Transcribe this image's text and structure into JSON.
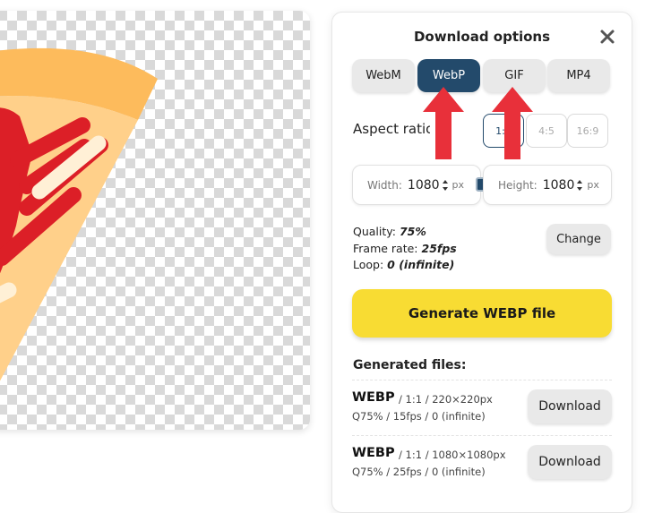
{
  "panel": {
    "title": "Download options",
    "close_icon": "close-icon"
  },
  "formats": [
    {
      "label": "WebM",
      "selected": false
    },
    {
      "label": "WebP",
      "selected": true
    },
    {
      "label": "GIF",
      "selected": false
    },
    {
      "label": "MP4",
      "selected": false
    }
  ],
  "aspect": {
    "label": "Aspect ratio",
    "options": [
      "1:1",
      "4:5",
      "16:9"
    ],
    "selected": "1:1"
  },
  "dimensions": {
    "width_label": "Width:",
    "width_value": "1080",
    "height_label": "Height:",
    "height_value": "1080",
    "unit": "px",
    "lock_icon": "lock-icon"
  },
  "settings": {
    "quality_label": "Quality:",
    "quality_value": "75%",
    "framerate_label": "Frame rate:",
    "framerate_value": "25fps",
    "loop_label": "Loop:",
    "loop_value": "0 (infinite)",
    "change_label": "Change"
  },
  "generate_label": "Generate WEBP file",
  "generated_title": "Generated files:",
  "files": [
    {
      "format": "WEBP",
      "meta1": "/ 1:1 / 220×220px",
      "meta2": "Q75% / 15fps / 0 (infinite)",
      "action": "Download"
    },
    {
      "format": "WEBP",
      "meta1": "/ 1:1 / 1080×1080px",
      "meta2": "Q75% / 25fps / 0 (infinite)",
      "action": "Download"
    }
  ],
  "colors": {
    "accent": "#234a6b",
    "generate": "#f8dc33",
    "annotation_arrow": "#e8303a",
    "pizza_crust": "#fdbb5c",
    "pizza_cheese": "#ffd08a",
    "pizza_sauce": "#dc1f27"
  }
}
